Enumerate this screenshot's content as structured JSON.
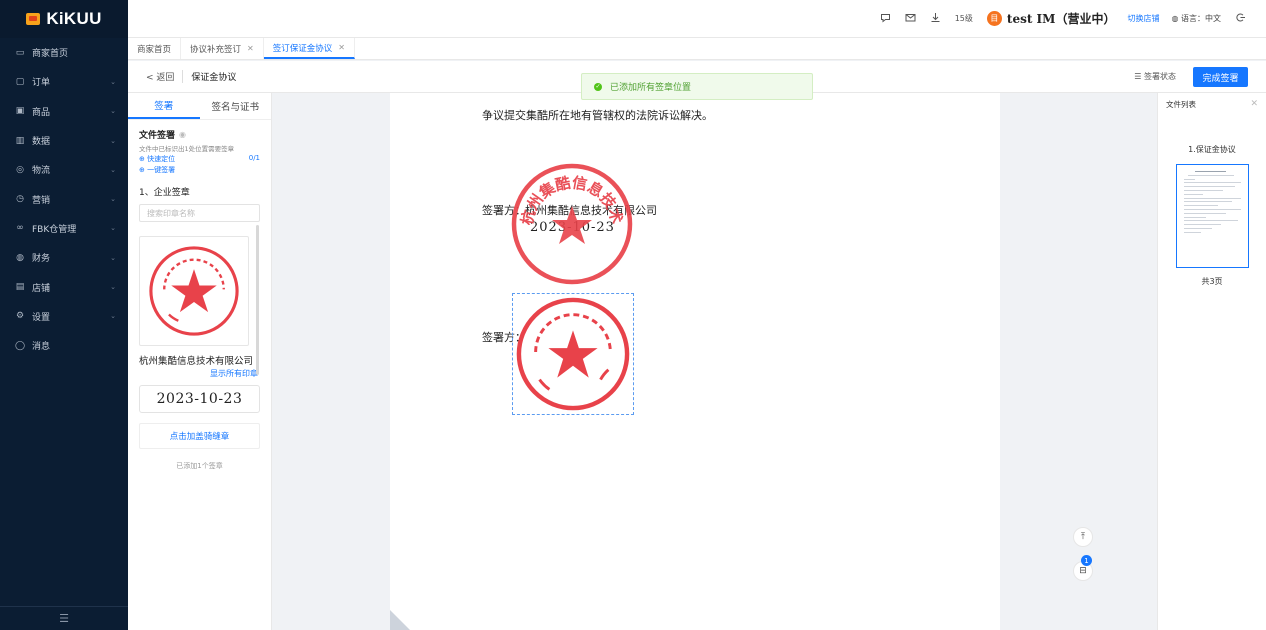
{
  "app": {
    "logo_text": "KiKUU"
  },
  "sidebar": {
    "items": [
      {
        "label": "商家首页",
        "icon": "monitor-icon",
        "glyph": "▭",
        "has_children": false
      },
      {
        "label": "订单",
        "icon": "order-icon",
        "glyph": "▢",
        "has_children": true
      },
      {
        "label": "商品",
        "icon": "product-icon",
        "glyph": "▣",
        "has_children": true
      },
      {
        "label": "数据",
        "icon": "chart-icon",
        "glyph": "▥",
        "has_children": true
      },
      {
        "label": "物流",
        "icon": "location-icon",
        "glyph": "◎",
        "has_children": true
      },
      {
        "label": "营销",
        "icon": "marketing-icon",
        "glyph": "◷",
        "has_children": true
      },
      {
        "label": "FBK仓管理",
        "icon": "warehouse-icon",
        "glyph": "∞",
        "has_children": true
      },
      {
        "label": "财务",
        "icon": "finance-icon",
        "glyph": "◍",
        "has_children": true
      },
      {
        "label": "店铺",
        "icon": "store-icon",
        "glyph": "▤",
        "has_children": true
      },
      {
        "label": "设置",
        "icon": "gear-icon",
        "glyph": "⚙",
        "has_children": true
      },
      {
        "label": "消息",
        "icon": "message-icon",
        "glyph": "◯",
        "has_children": false
      }
    ],
    "chevron": "⌄",
    "collapse_glyph": "☰"
  },
  "header": {
    "level": "15级",
    "shop_badge": "目",
    "shop_name": "test IM（营业中）",
    "switch_shop": "切换店铺",
    "language": "语言：中文",
    "icons": [
      "chat-icon",
      "mail-icon",
      "download-icon"
    ]
  },
  "tabs": [
    {
      "label": "商家首页",
      "closable": false,
      "active": false
    },
    {
      "label": "协议补充签订",
      "closable": true,
      "active": false
    },
    {
      "label": "签订保证金协议",
      "closable": true,
      "active": true
    }
  ],
  "subheader": {
    "back": "< 返回",
    "title": "保证金协议",
    "sign_status": "签署状态",
    "finish_button": "完成签署"
  },
  "toast": {
    "message": "已添加所有签章位置"
  },
  "left_panel": {
    "tabs": [
      "签署",
      "签名与证书"
    ],
    "file_sign_title": "文件签署",
    "file_sign_desc": "文件中已标识出1处位置需要签章",
    "quick_locate": "⊕ 快速定位",
    "progress": "0/1",
    "one_click_sign": "⊕ 一键签署",
    "enterprise_title": "1、企业签章",
    "search_placeholder": "搜索印章名称",
    "company_name": "杭州集酷信息技术有限公司",
    "show_all_seals": "显示所有印章",
    "date": "2023-10-23",
    "perforation_button": "点击加盖骑缝章",
    "added_count": "已添加1个签章"
  },
  "document": {
    "clause_text": "争议提交集酷所在地有管辖权的法院诉讼解决。",
    "signer_label_1": "签署方：",
    "signer_company_1": "杭州集酷信息技术有限公司",
    "signer_date_1": "2023-10-23",
    "signer_label_2": "签署方：",
    "seal_text": "杭州集酷信息技术有限公司"
  },
  "right_panel": {
    "title": "文件列表",
    "doc_name": "1.保证金协议",
    "pages": "共3页"
  },
  "float": {
    "top_glyph": "⤒",
    "doc_glyph": "⊟",
    "badge": "1"
  },
  "colors": {
    "sidebar_bg": "#0b1d33",
    "accent": "#1677ff",
    "seal_red": "#e8424a",
    "success": "#52c41a",
    "shop_badge": "#f5731f"
  }
}
